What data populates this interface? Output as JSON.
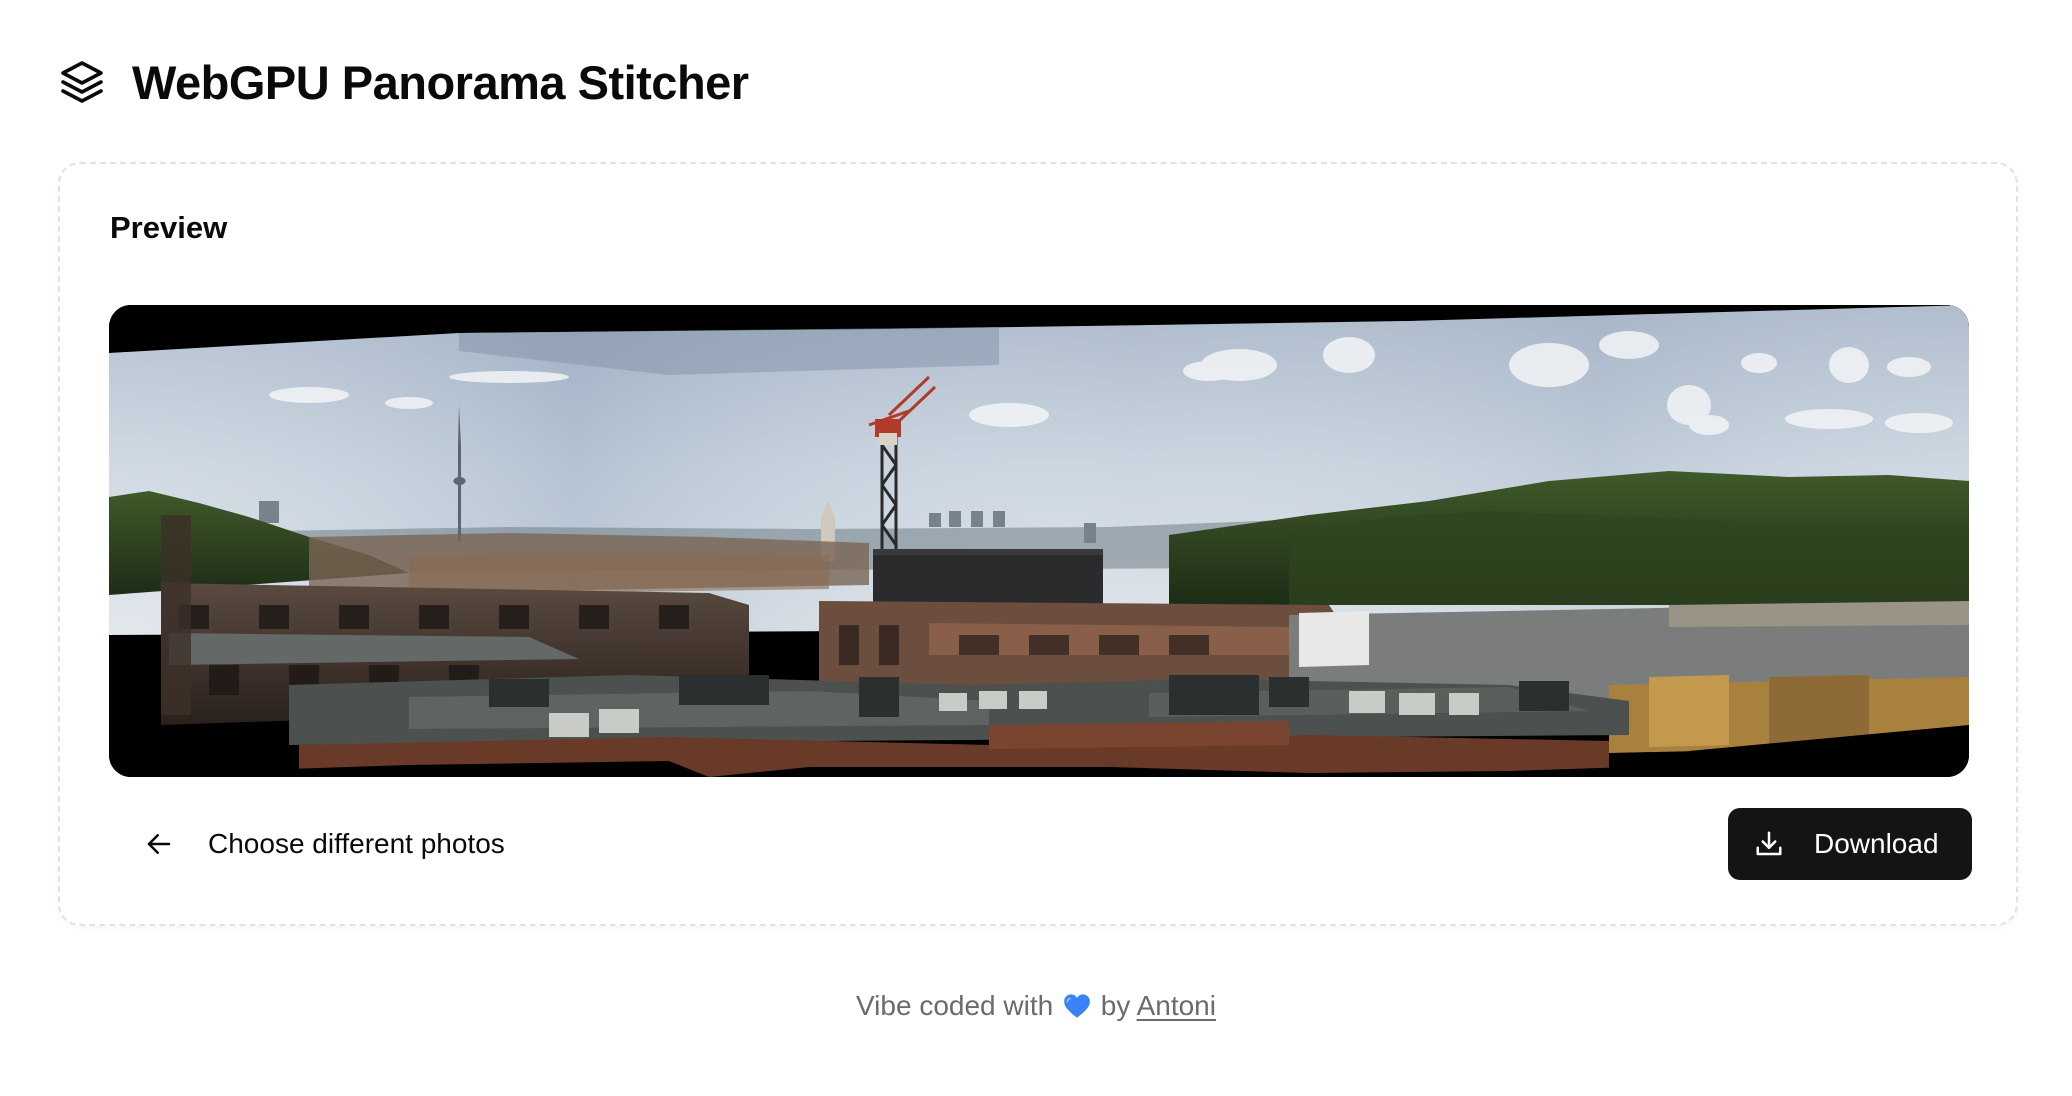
{
  "header": {
    "logo_icon": "layers-icon",
    "title": "WebGPU Panorama Stitcher"
  },
  "preview": {
    "title": "Preview",
    "image_alt": "Stitched panorama of a city skyline with rooftops, a crane and a TV tower"
  },
  "actions": {
    "back_label": "Choose different photos",
    "back_icon": "arrow-left-icon",
    "download_label": "Download",
    "download_icon": "download-icon"
  },
  "footer": {
    "prefix": "Vibe coded with",
    "heart_icon": "blue-heart-icon",
    "by": "by",
    "author": "Antoni"
  },
  "colors": {
    "primary_button": "#141414",
    "text": "#0a0a0a",
    "muted_text": "#6b6b6b",
    "heart": "#3b82f6"
  }
}
